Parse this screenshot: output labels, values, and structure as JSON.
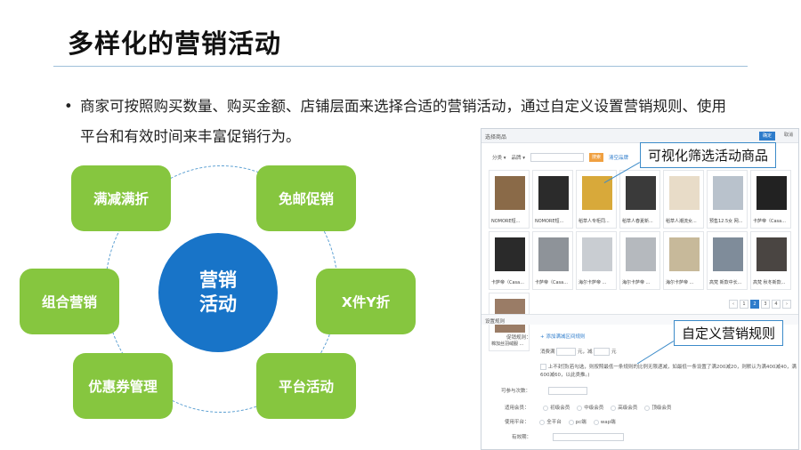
{
  "slide": {
    "title": "多样化的营销活动",
    "bullet": "商家可按照购买数量、购买金额、店铺层面来选择合适的营销活动，通过自定义设置营销规则、使用平台和有效时间来丰富促销行为。"
  },
  "wheel": {
    "hub": [
      "营销",
      "活动"
    ],
    "items": [
      "满减满折",
      "免邮促销",
      "组合营销",
      "X件Y折",
      "优惠券管理",
      "平台活动"
    ]
  },
  "panel": {
    "header": "选择商品",
    "confirm": "确定",
    "cancel": "取消",
    "filters": {
      "category": "分类 ▾",
      "brand": "品牌 ▾",
      "search": "搜索",
      "link": "清空品牌"
    },
    "products": [
      "NOMORE短...",
      "NOMORE短...",
      "稻草人专柜同...",
      "稻草人春夏新...",
      "稻草人潮流女...",
      "预售12.5女 网...",
      "卡萨帝（Casa...",
      "卡萨帝（Casa...",
      "卡萨帝（Casa...",
      "海尔卡萨帝 ...",
      "海尔卡萨帝 ...",
      "海尔卡萨帝 ...",
      "高梵 新款中长...",
      "高梵 秋冬新款...",
      "棉加丝羽绒服 ..."
    ],
    "pager": [
      "‹",
      "1",
      "2",
      "3",
      "4",
      "›"
    ],
    "rules_title": "设置规则",
    "form": {
      "promo_rule": "促销规则：",
      "add_rule": "添加满减区间规则",
      "consume": "消费满",
      "yuan1": "元，减",
      "yuan2": "元",
      "note": "上不封顶(若勾选，则按照最低一条规则的比例无限递减，如最低一条设置了满200减20，则默认为满400减40，满600减60，以此类推。)",
      "times": "可参与次数：",
      "member": "适用会员：",
      "members": [
        "初级会员",
        "中级会员",
        "高级会员",
        "顶级会员"
      ],
      "platform": "使用平台：",
      "platforms": [
        "全平台",
        "pc端",
        "wap端"
      ],
      "valid": "有效期："
    }
  },
  "callouts": {
    "top": "可视化筛选活动商品",
    "bottom": "自定义营销规则"
  },
  "colors": {
    "green": "#86c63f",
    "blue": "#1874c8",
    "accent": "#2e7ccb"
  }
}
